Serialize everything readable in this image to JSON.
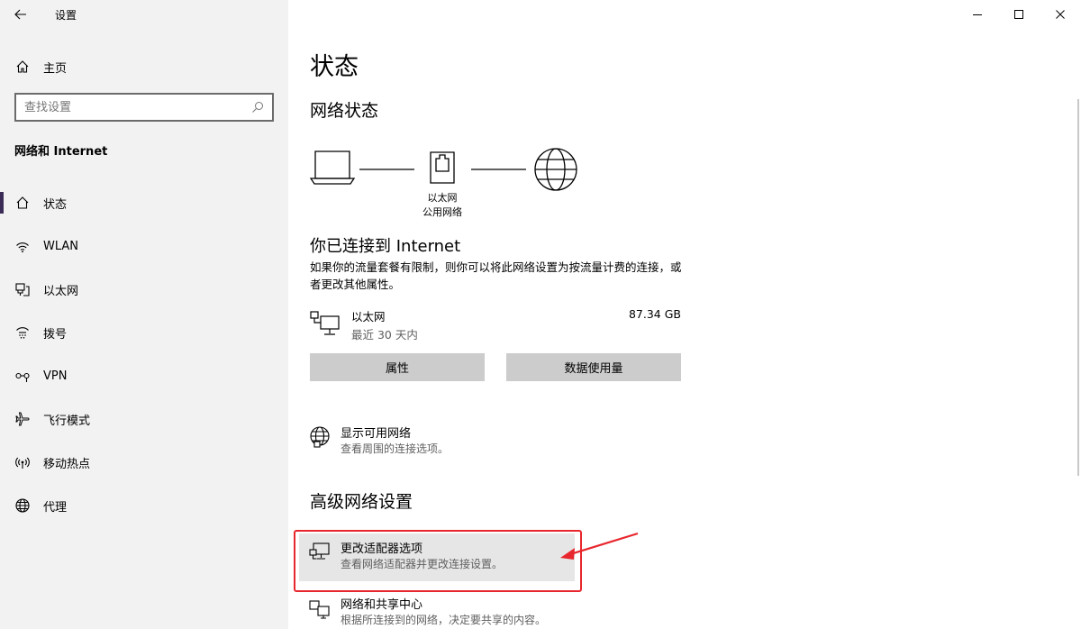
{
  "app": {
    "title": "设置"
  },
  "sidebar": {
    "home_label": "主页",
    "search_placeholder": "查找设置",
    "section_title": "网络和 Internet",
    "items": [
      {
        "label": "状态",
        "icon": "home-status-icon",
        "active": true
      },
      {
        "label": "WLAN",
        "icon": "wifi-icon"
      },
      {
        "label": "以太网",
        "icon": "ethernet-icon"
      },
      {
        "label": "拨号",
        "icon": "dialup-icon"
      },
      {
        "label": "VPN",
        "icon": "vpn-icon"
      },
      {
        "label": "飞行模式",
        "icon": "airplane-icon"
      },
      {
        "label": "移动热点",
        "icon": "hotspot-icon"
      },
      {
        "label": "代理",
        "icon": "globe-icon"
      }
    ]
  },
  "main": {
    "page_title": "状态",
    "network_status_heading": "网络状态",
    "diagram": {
      "adapter_label": "以太网",
      "network_type": "公用网络"
    },
    "connected_title": "你已连接到 Internet",
    "connected_desc": "如果你的流量套餐有限制，则你可以将此网络设置为按流量计费的连接，或者更改其他属性。",
    "ethernet": {
      "name": "以太网",
      "period": "最近 30 天内",
      "usage": "87.34 GB"
    },
    "buttons": {
      "properties": "属性",
      "data_usage": "数据使用量"
    },
    "show_networks": {
      "title": "显示可用网络",
      "desc": "查看周围的连接选项。"
    },
    "advanced_heading": "高级网络设置",
    "change_adapter": {
      "title": "更改适配器选项",
      "desc": "查看网络适配器并更改连接设置。"
    },
    "sharing_center": {
      "title": "网络和共享中心",
      "desc": "根据所连接到的网络，决定要共享的内容。"
    }
  },
  "colors": {
    "sidebar_bg": "#f2f2f2",
    "active_indicator": "#3a2b57",
    "button_bg": "#cccccc",
    "annotation": "#e8262d"
  }
}
